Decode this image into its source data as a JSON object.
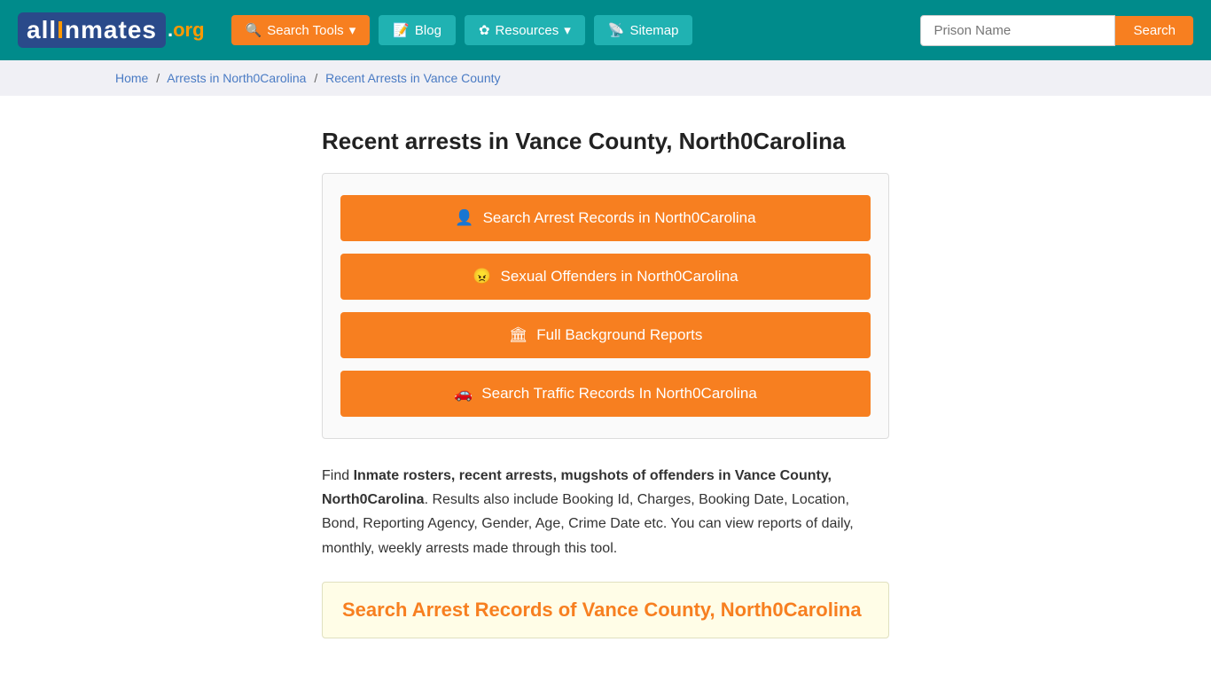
{
  "navbar": {
    "logo": {
      "part1": "all",
      "part2": "I",
      "part3": "nmates",
      "part4": ".org"
    },
    "search_tools_label": "Search Tools",
    "blog_label": "Blog",
    "resources_label": "Resources",
    "sitemap_label": "Sitemap",
    "prison_name_placeholder": "Prison Name",
    "search_button_label": "Search"
  },
  "breadcrumb": {
    "home": "Home",
    "arrests": "Arrests in North0Carolina",
    "current": "Recent Arrests in Vance County"
  },
  "main": {
    "page_title": "Recent arrests in Vance County, North0Carolina",
    "action_buttons": [
      {
        "label": "Search Arrest Records in North0Carolina",
        "icon": "👤"
      },
      {
        "label": "Sexual Offenders in North0Carolina",
        "icon": "😠"
      },
      {
        "label": "Full Background Reports",
        "icon": "🏛"
      },
      {
        "label": "Search Traffic Records In North0Carolina",
        "icon": "🚗"
      }
    ],
    "desc_text_prefix": "Find ",
    "desc_bold": "Inmate rosters, recent arrests, mugshots of offenders in Vance County, North0Carolina",
    "desc_text_suffix": ". Results also include Booking Id, Charges, Booking Date, Location, Bond, Reporting Agency, Gender, Age, Crime Date etc. You can view reports of daily, monthly, weekly arrests made through this tool.",
    "search_records_title": "Search Arrest Records of Vance County, North0Carolina"
  }
}
